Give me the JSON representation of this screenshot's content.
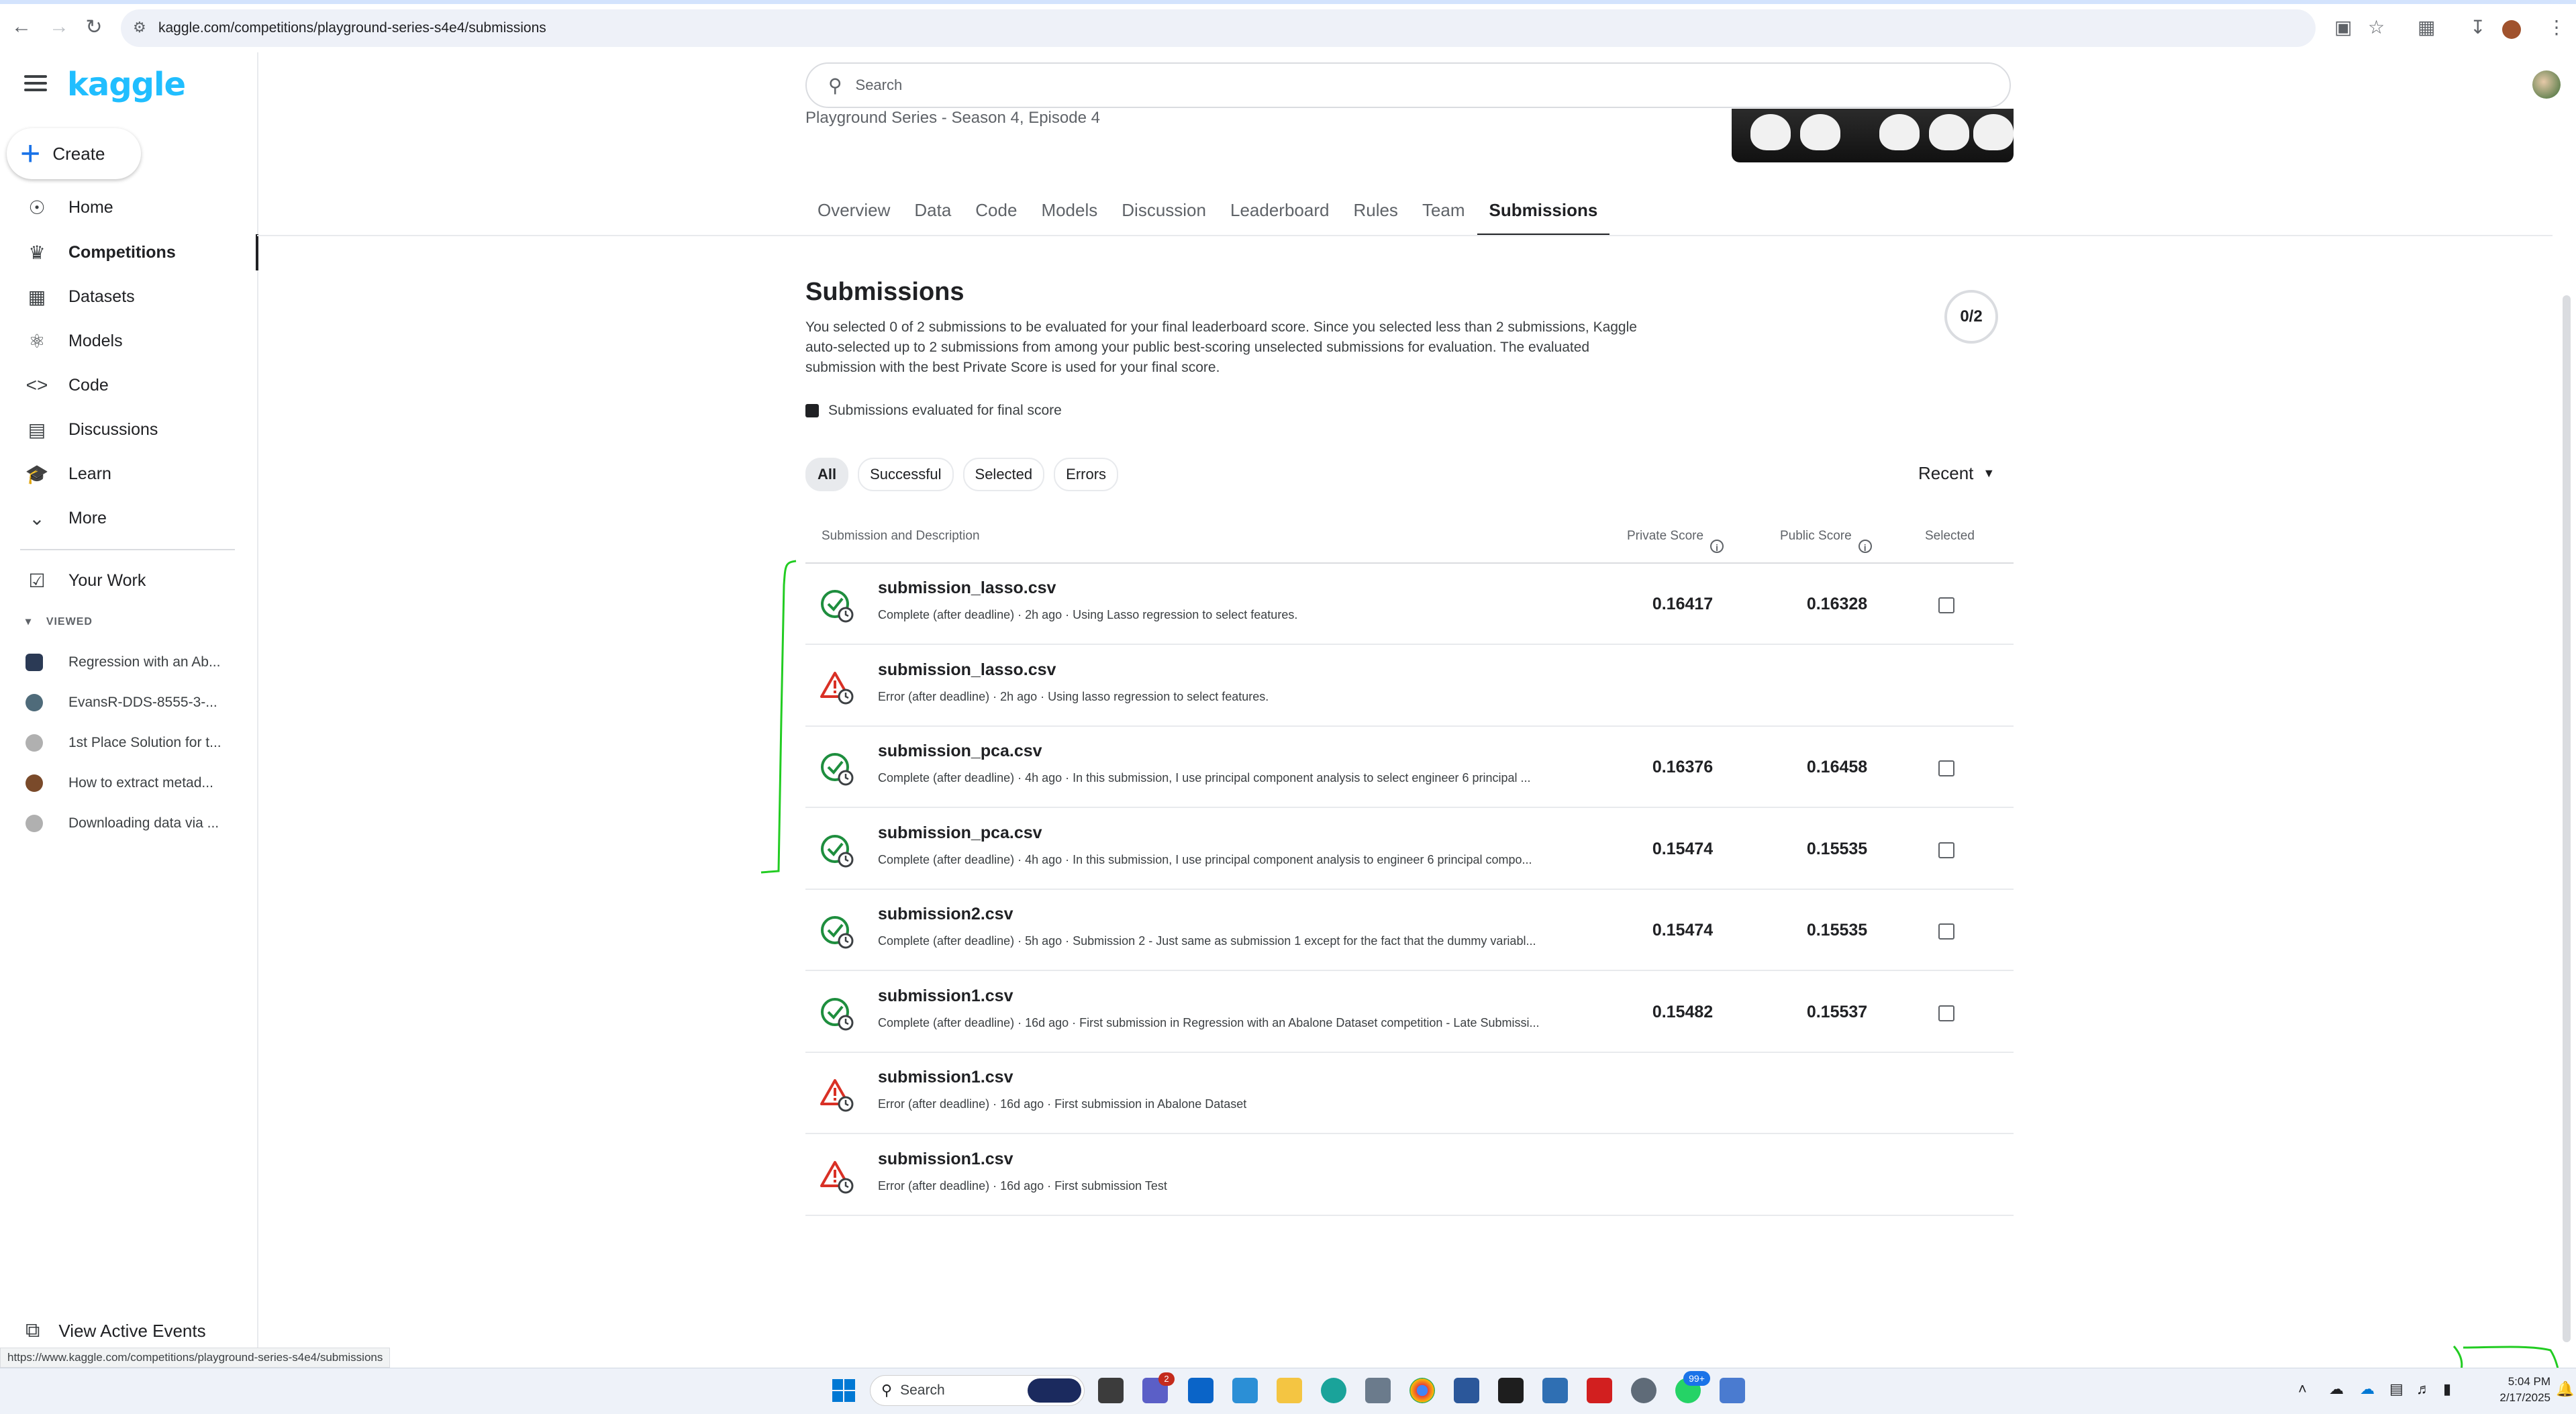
{
  "browser": {
    "url": "kaggle.com/competitions/playground-series-s4e4/submissions"
  },
  "sidebar": {
    "logo": "kaggle",
    "create_label": "Create",
    "nav": [
      {
        "label": "Home",
        "icon": "compass-icon"
      },
      {
        "label": "Competitions",
        "icon": "trophy-icon"
      },
      {
        "label": "Datasets",
        "icon": "table-icon"
      },
      {
        "label": "Models",
        "icon": "models-icon"
      },
      {
        "label": "Code",
        "icon": "code-icon"
      },
      {
        "label": "Discussions",
        "icon": "discussion-icon"
      },
      {
        "label": "Learn",
        "icon": "learn-icon"
      },
      {
        "label": "More",
        "icon": "chevron-down-icon"
      }
    ],
    "your_work": "Your Work",
    "viewed_header": "VIEWED",
    "viewed": [
      "Regression with an Ab...",
      "EvansR-DDS-8555-3-...",
      "1st Place Solution for t...",
      "How to extract metad...",
      "Downloading data via ..."
    ],
    "view_active_events": "View Active Events"
  },
  "search": {
    "placeholder": "Search"
  },
  "competition": {
    "subtitle": "Playground Series - Season 4, Episode 4"
  },
  "tabs": [
    "Overview",
    "Data",
    "Code",
    "Models",
    "Discussion",
    "Leaderboard",
    "Rules",
    "Team",
    "Submissions"
  ],
  "submissions": {
    "title": "Submissions",
    "description": "You selected 0 of 2 submissions to be evaluated for your final leaderboard score. Since you selected less than 2 submissions, Kaggle auto-selected up to 2 submissions from among your public best-scoring unselected submissions for evaluation. The evaluated submission with the best Private Score is used for your final score.",
    "counter": "0/2",
    "legend": "Submissions evaluated for final score",
    "filters": [
      "All",
      "Successful",
      "Selected",
      "Errors"
    ],
    "sort": "Recent",
    "columns": {
      "submission": "Submission and Description",
      "private": "Private Score",
      "public": "Public Score",
      "selected": "Selected"
    },
    "rows": [
      {
        "status": "success",
        "file": "submission_lasso.csv",
        "meta": "Complete (after deadline) · 2h ago · Using Lasso regression to select features.",
        "private": "0.16417",
        "public": "0.16328"
      },
      {
        "status": "error",
        "file": "submission_lasso.csv",
        "meta": "Error (after deadline) · 2h ago · Using lasso regression to select features.",
        "private": "",
        "public": ""
      },
      {
        "status": "success",
        "file": "submission_pca.csv",
        "meta": "Complete (after deadline) · 4h ago · In this submission, I use principal component analysis to select engineer 6 principal ...",
        "private": "0.16376",
        "public": "0.16458"
      },
      {
        "status": "success",
        "file": "submission_pca.csv",
        "meta": "Complete (after deadline) · 4h ago · In this submission, I use principal component analysis to engineer 6 principal compo...",
        "private": "0.15474",
        "public": "0.15535"
      },
      {
        "status": "success",
        "file": "submission2.csv",
        "meta": "Complete (after deadline) · 5h ago · Submission 2 - Just same as submission 1 except for the fact that the dummy variabl...",
        "private": "0.15474",
        "public": "0.15535"
      },
      {
        "status": "success",
        "file": "submission1.csv",
        "meta": "Complete (after deadline) · 16d ago · First submission in Regression with an Abalone Dataset competition - Late Submissi...",
        "private": "0.15482",
        "public": "0.15537"
      },
      {
        "status": "error",
        "file": "submission1.csv",
        "meta": "Error (after deadline) · 16d ago · First submission in Abalone Dataset",
        "private": "",
        "public": ""
      },
      {
        "status": "error",
        "file": "submission1.csv",
        "meta": "Error (after deadline) · 16d ago · First submission Test",
        "private": "",
        "public": ""
      }
    ]
  },
  "status_url": "https://www.kaggle.com/competitions/playground-series-s4e4/submissions",
  "taskbar": {
    "search": "Search",
    "badge_teams": "2",
    "badge_whatsapp": "99+",
    "time": "5:04 PM",
    "date": "2/17/2025"
  },
  "colors": {
    "kaggle_blue": "#20beff",
    "success_green": "#1e8e3e",
    "error_orange": "#d93025",
    "annotation_green": "#22cc22"
  }
}
